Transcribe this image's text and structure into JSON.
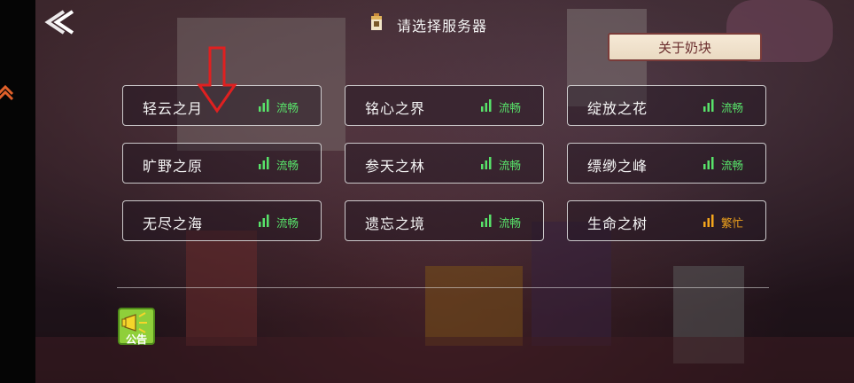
{
  "header": {
    "title": "请选择服务器",
    "about_label": "关于奶块"
  },
  "servers": [
    {
      "name": "轻云之月",
      "status": "流畅",
      "status_type": "ok"
    },
    {
      "name": "铭心之界",
      "status": "流畅",
      "status_type": "ok"
    },
    {
      "name": "绽放之花",
      "status": "流畅",
      "status_type": "ok"
    },
    {
      "name": "旷野之原",
      "status": "流畅",
      "status_type": "ok"
    },
    {
      "name": "参天之林",
      "status": "流畅",
      "status_type": "ok"
    },
    {
      "name": "缥缈之峰",
      "status": "流畅",
      "status_type": "ok"
    },
    {
      "name": "无尽之海",
      "status": "流畅",
      "status_type": "ok"
    },
    {
      "name": "遗忘之境",
      "status": "流畅",
      "status_type": "ok"
    },
    {
      "name": "生命之树",
      "status": "繁忙",
      "status_type": "busy"
    }
  ],
  "footer": {
    "notice_label": "公告"
  },
  "colors": {
    "status_ok": "#58e36a",
    "status_busy": "#f3a51c",
    "annotation_arrow": "#e02020",
    "about_border": "#7a3b39"
  },
  "icons": {
    "back": "back-arrow-icon",
    "signal": "signal-bars-icon",
    "notice": "megaphone-icon",
    "title": "milk-block-icon"
  }
}
